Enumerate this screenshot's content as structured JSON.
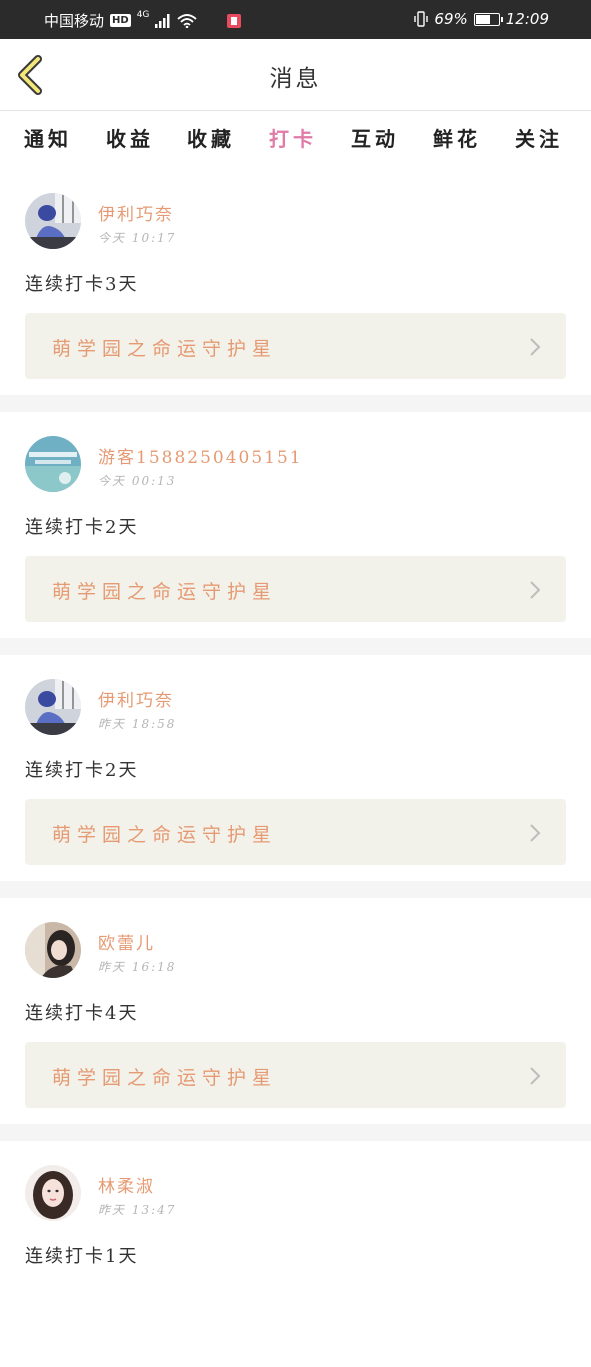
{
  "status_bar": {
    "carrier": "中国移动",
    "hd": "HD",
    "network": "4G",
    "battery_percent": "69%",
    "battery_level": 0.69,
    "time": "12:09"
  },
  "header": {
    "title": "消息",
    "back_icon": "chevron-left-icon"
  },
  "tabs": [
    {
      "label": "通知",
      "active": false
    },
    {
      "label": "收益",
      "active": false
    },
    {
      "label": "收藏",
      "active": false
    },
    {
      "label": "打卡",
      "active": true
    },
    {
      "label": "互动",
      "active": false
    },
    {
      "label": "鲜花",
      "active": false
    },
    {
      "label": "关注",
      "active": false
    }
  ],
  "colors": {
    "accent_pink": "#e07aa7",
    "username_orange": "#e59a73",
    "card_bg": "#f3f2ea",
    "status_bar_bg": "#2b2b2b"
  },
  "feed": [
    {
      "user": "伊利巧奈",
      "time": "今天 10:17",
      "text": "连续打卡3天",
      "card": "萌学园之命运守护星"
    },
    {
      "user": "游客1588250405151",
      "time": "今天 00:13",
      "text": "连续打卡2天",
      "card": "萌学园之命运守护星"
    },
    {
      "user": "伊利巧奈",
      "time": "昨天 18:58",
      "text": "连续打卡2天",
      "card": "萌学园之命运守护星"
    },
    {
      "user": "欧蕾儿",
      "time": "昨天 16:18",
      "text": "连续打卡4天",
      "card": "萌学园之命运守护星"
    },
    {
      "user": "林柔淑",
      "time": "昨天 13:47",
      "text": "连续打卡1天",
      "card": ""
    }
  ]
}
